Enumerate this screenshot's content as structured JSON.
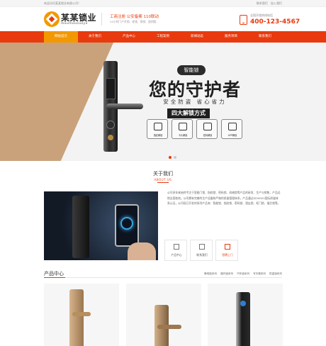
{
  "topbar": {
    "welcome": "欢迎访问某某锁业有限公司！",
    "links": [
      "联系我们",
      "加入我们"
    ]
  },
  "header": {
    "logo_name": "某某锁业",
    "logo_pinyin": "moumousuoye",
    "slogan_main": "工商注册 公安备案 110联动",
    "slogan_sub": "24小时门户开锁、修锁、换锁、配钥匙",
    "hotline_label": "全国开锁热线电话",
    "hotline_number": "400-123-4567"
  },
  "nav": {
    "items": [
      "网站首页",
      "关于我们",
      "产品中心",
      "工程案例",
      "新闻动态",
      "服务项目",
      "联系我们"
    ],
    "active_index": 0
  },
  "banner": {
    "tag": "智能锁",
    "title": "您的守护者",
    "subtitle": "安全防盗 省心省力",
    "methods_title": "四大解锁方式",
    "methods": [
      "指纹解锁",
      "卡片解锁",
      "密码解锁",
      "APP解锁"
    ],
    "slide_count": 2,
    "active_slide": 0
  },
  "about": {
    "title": "关于我们",
    "subtitle": "ABOUT US",
    "text": "公司多年来始终专注于智能门锁、指纹锁、密码锁、机械锁等产品的研发、生产与销售，产品远销全国各地。公司拥有完善的生产设备和严格的质量管理体系，产品通过ISO9001国际质量体系认证，公司现已开发的系列产品有：智能锁、指纹锁、密码锁、酒店锁、柜门锁、插芯锁等。",
    "boxes": [
      "产品中心",
      "联系我们",
      "招聘上门"
    ],
    "active_box": 2
  },
  "products": {
    "title": "产品中心",
    "categories": [
      "静电贴系列",
      "循环锁系列",
      "汽车锁系列",
      "写字楼系列",
      "防盗锁系列"
    ]
  },
  "colors": {
    "accent": "#e83a0e",
    "accent_secondary": "#f39800"
  }
}
